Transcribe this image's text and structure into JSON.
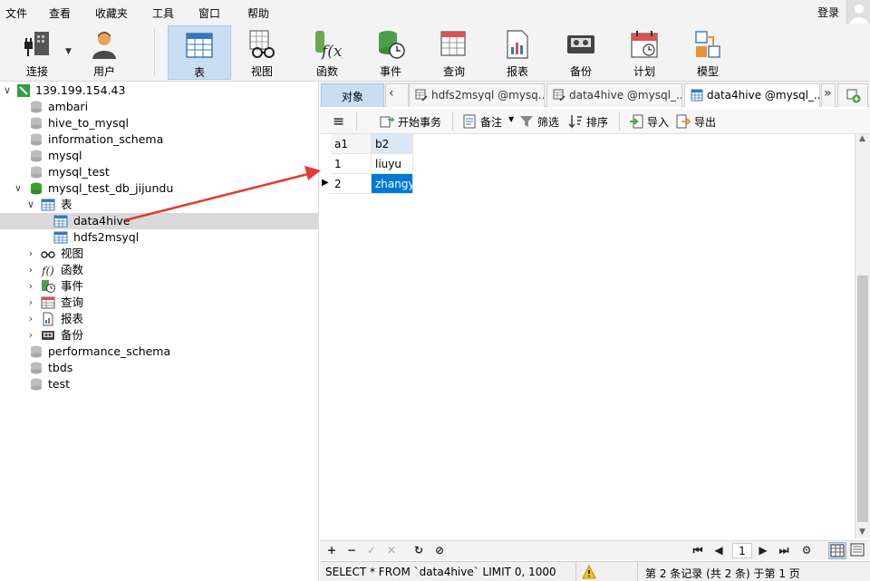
{
  "menu": {
    "items": [
      "文件",
      "查看",
      "收藏夹",
      "工具",
      "窗口",
      "帮助"
    ],
    "login": "登录"
  },
  "toolbar": {
    "connect": "连接",
    "user": "用户",
    "table": "表",
    "view": "视图",
    "function": "函数",
    "event": "事件",
    "query": "查询",
    "report": "报表",
    "backup": "备份",
    "schedule": "计划",
    "model": "模型"
  },
  "tree": {
    "server": "139.199.154.43",
    "dbs_before": [
      "ambari",
      "hive_to_mysql",
      "information_schema",
      "mysql",
      "mysql_test"
    ],
    "open_db": "mysql_test_db_jijundu",
    "tables_label": "表",
    "tables": [
      "data4hive",
      "hdfs2msyql"
    ],
    "groups": [
      "视图",
      "函数",
      "事件",
      "查询",
      "报表",
      "备份"
    ],
    "dbs_after": [
      "performance_schema",
      "tbds",
      "test"
    ]
  },
  "tabs": {
    "objects": "对象",
    "tab1": "hdfs2msyql @mysq...",
    "tab2": "data4hive @mysql_...",
    "tab3": "data4hive @mysql_..."
  },
  "objbar": {
    "begin_tx": "开始事务",
    "memo": "备注",
    "filter": "筛选",
    "sort": "排序",
    "import": "导入",
    "export": "导出"
  },
  "grid": {
    "columns": [
      "a1",
      "b2"
    ],
    "rows": [
      [
        "1",
        "liuyu"
      ],
      [
        "2",
        "zhangyu"
      ]
    ]
  },
  "pager": {
    "page": "1"
  },
  "status": {
    "sql": "SELECT * FROM `data4hive` LIMIT 0, 1000",
    "records": "第 2 条记录 (共 2 条) 于第 1 页"
  },
  "colors": {
    "accent": "#0078d7",
    "arrow": "#e53935",
    "active_tab": "#c9def3"
  }
}
